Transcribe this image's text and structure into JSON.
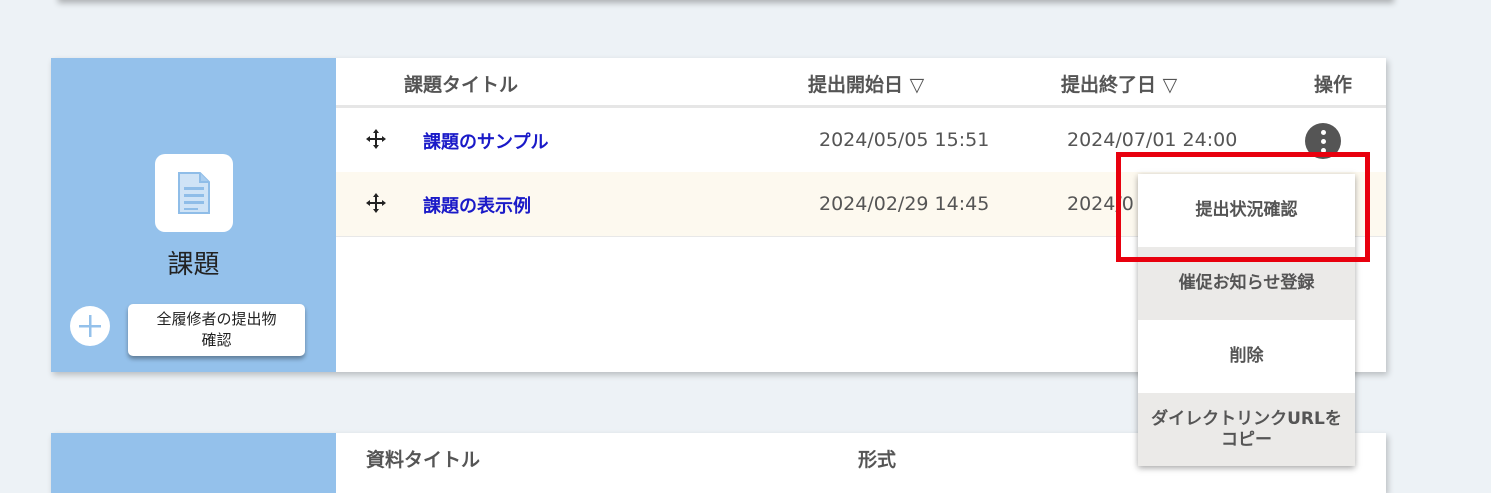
{
  "assignments": {
    "sidebar": {
      "label": "課題",
      "collect_button_line1": "全履修者の提出物",
      "collect_button_line2": "確認"
    },
    "columns": {
      "title": "課題タイトル",
      "start_date": "提出開始日 ▽",
      "end_date": "提出終了日 ▽",
      "actions": "操作"
    },
    "rows": [
      {
        "title": "課題のサンプル",
        "start": "2024/05/05 15:51",
        "end": "2024/07/01 24:00"
      },
      {
        "title": "課題の表示例",
        "start": "2024/02/29 14:45",
        "end": "2024/0"
      }
    ]
  },
  "context_menu": {
    "items": [
      {
        "label_line1": "提出状況確認",
        "label_line2": ""
      },
      {
        "label_line1": "催促お知らせ登録",
        "label_line2": ""
      },
      {
        "label_line1": "削除",
        "label_line2": ""
      },
      {
        "label_line1": "ダイレクトリンクURLを",
        "label_line2": "コピー"
      }
    ]
  },
  "materials": {
    "columns": {
      "title": "資料タイトル",
      "format": "形式"
    }
  },
  "icons": {
    "assignment": "document-icon",
    "add": "plus-icon",
    "move": "move-icon",
    "more": "kebab-menu-icon"
  },
  "colors": {
    "sidebar_bg": "#94c1eb",
    "link": "#1a1ac8",
    "highlight_border": "#e8000e",
    "alt_row_bg": "#fdf9ef"
  }
}
